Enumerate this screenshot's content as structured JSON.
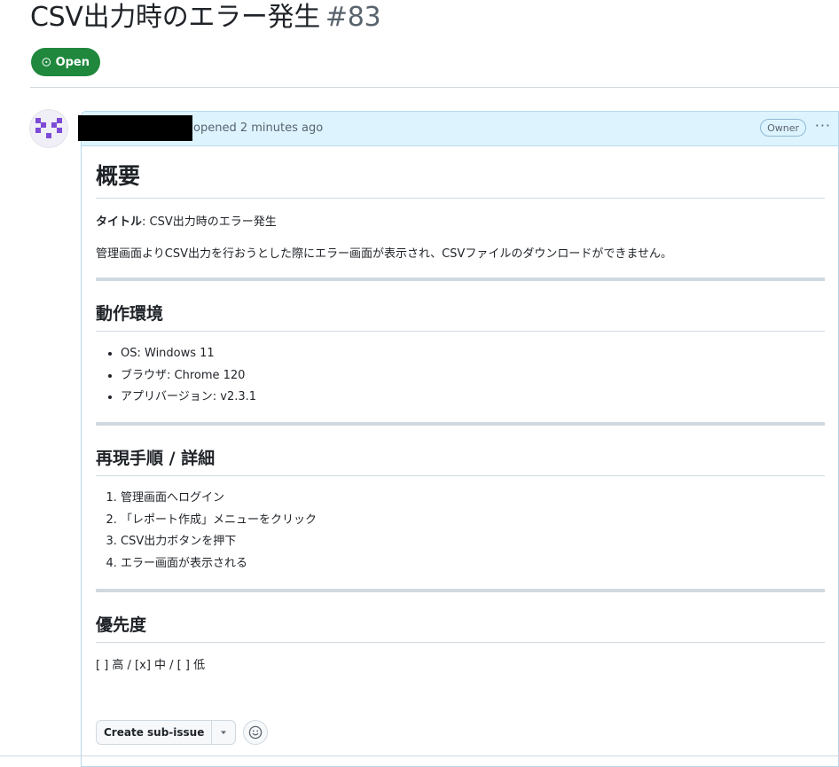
{
  "issue": {
    "title": "CSV出力時のエラー発生",
    "number": "#83",
    "state": "Open"
  },
  "comment": {
    "opened_text": "opened 2 minutes ago",
    "badge": "Owner",
    "menu_glyph": "···"
  },
  "content": {
    "overview": {
      "heading": "概要",
      "title_label": "タイトル",
      "title_value": ": CSV出力時のエラー発生",
      "description": "管理画面よりCSV出力を行おうとした際にエラー画面が表示され、CSVファイルのダウンロードができません。"
    },
    "environment": {
      "heading": "動作環境",
      "items": [
        "OS: Windows 11",
        "ブラウザ: Chrome 120",
        "アプリバージョン: v2.3.1"
      ]
    },
    "steps": {
      "heading": "再現手順 / 詳細",
      "items": [
        "管理画面へログイン",
        "「レポート作成」メニューをクリック",
        "CSV出力ボタンを押下",
        "エラー画面が表示される"
      ]
    },
    "priority": {
      "heading": "優先度",
      "text": "[ ] 高 / [x] 中 / [ ] 低"
    }
  },
  "actions": {
    "create_sub_issue": "Create sub-issue"
  },
  "colors": {
    "open_green": "#1f883d",
    "header_blue": "#ddf4ff",
    "avatar_purple": "#7c4ad6"
  }
}
